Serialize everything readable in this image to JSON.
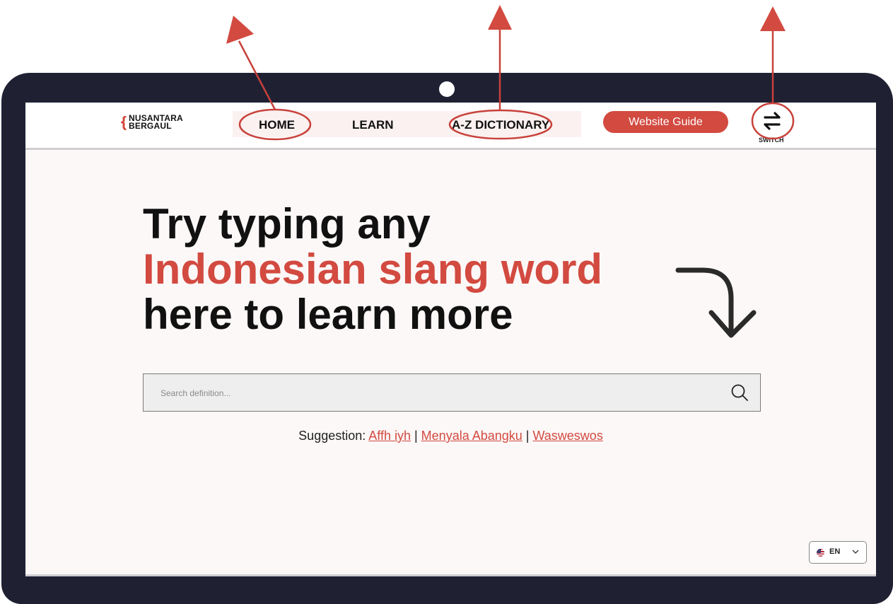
{
  "logo": {
    "line1": "NUSANTARA",
    "line2": "BERGAUL"
  },
  "nav": {
    "home": "HOME",
    "learn": "LEARN",
    "dictionary": "A-Z DICTIONARY",
    "guide_button": "Website Guide",
    "switch_label": "SWITCH"
  },
  "hero": {
    "line1": "Try typing any",
    "line2": "Indonesian slang word",
    "line3": "here to learn more"
  },
  "search": {
    "placeholder": "Search definition..."
  },
  "suggestion": {
    "prefix": "Suggestion: ",
    "items": [
      "Affh iyh",
      "Menyala Abangku",
      "Wasweswos "
    ],
    "separator": " | "
  },
  "language": {
    "code": "EN",
    "flag": "us-flag-icon"
  },
  "colors": {
    "accent": "#d24a40",
    "frame": "#1f2133",
    "annotation": "#d24a40"
  },
  "icons": [
    "switch-icon",
    "search-icon",
    "curved-arrow-icon",
    "chevron-down-icon"
  ]
}
